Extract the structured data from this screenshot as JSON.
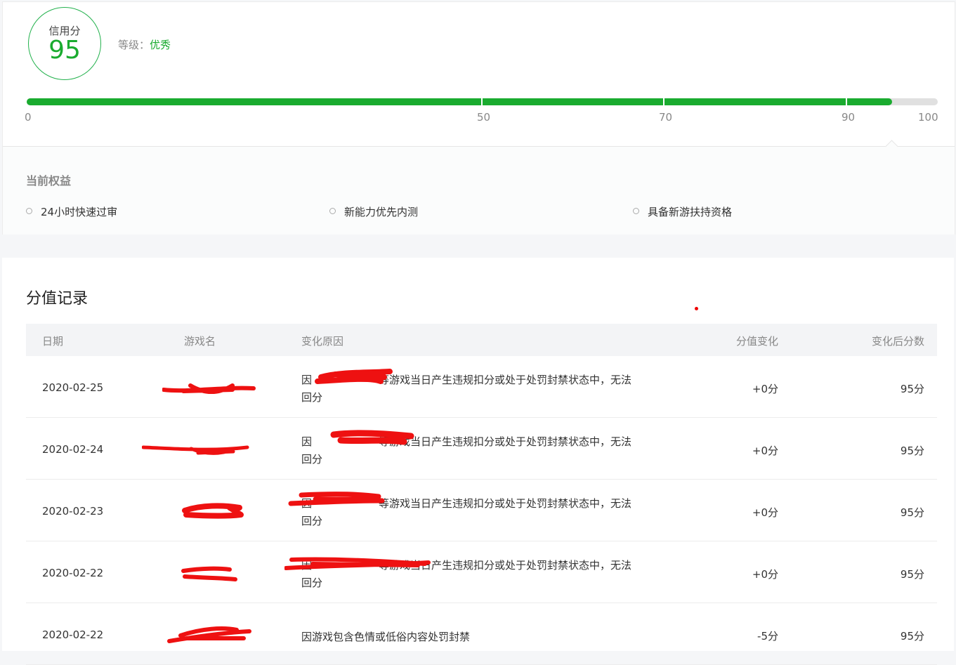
{
  "credit": {
    "label": "信用分",
    "score": "95",
    "level_label": "等级：",
    "level_value": "优秀",
    "progress_fraction": 0.95,
    "ticks": [
      "0",
      "50",
      "70",
      "90",
      "100"
    ],
    "colors": {
      "accent": "#1aab2f",
      "track": "#e0e0e0"
    }
  },
  "benefits": {
    "title": "当前权益",
    "items": [
      "24小时快速过审",
      "新能力优先内测",
      "具备新游扶持资格"
    ]
  },
  "records": {
    "title": "分值记录",
    "columns": [
      "日期",
      "游戏名",
      "变化原因",
      "分值变化",
      "变化后分数"
    ],
    "rows": [
      {
        "date": "2020-02-25",
        "reason_prefix": "因",
        "reason": "等游戏当日产生违规扣分或处于处罚封禁状态中，无法",
        "reason_line2": "回分",
        "delta": "+0分",
        "after": "95分"
      },
      {
        "date": "2020-02-24",
        "reason_prefix": "因",
        "reason": "等游戏当日产生违规扣分或处于处罚封禁状态中，无法",
        "reason_line2": "回分",
        "delta": "+0分",
        "after": "95分"
      },
      {
        "date": "2020-02-23",
        "reason_prefix": "因",
        "reason": "等游戏当日产生违规扣分或处于处罚封禁状态中，无法",
        "reason_line2": "回分",
        "delta": "+0分",
        "after": "95分"
      },
      {
        "date": "2020-02-22",
        "reason_prefix": "因",
        "reason": "等游戏当日产生违规扣分或处于处罚封禁状态中，无法",
        "reason_line2": "回分",
        "delta": "+0分",
        "after": "95分"
      },
      {
        "date": "2020-02-22",
        "reason_prefix": "",
        "reason": "因游戏包含色情或低俗内容处罚封禁",
        "reason_line2": "",
        "delta": "-5分",
        "after": "95分"
      }
    ]
  }
}
